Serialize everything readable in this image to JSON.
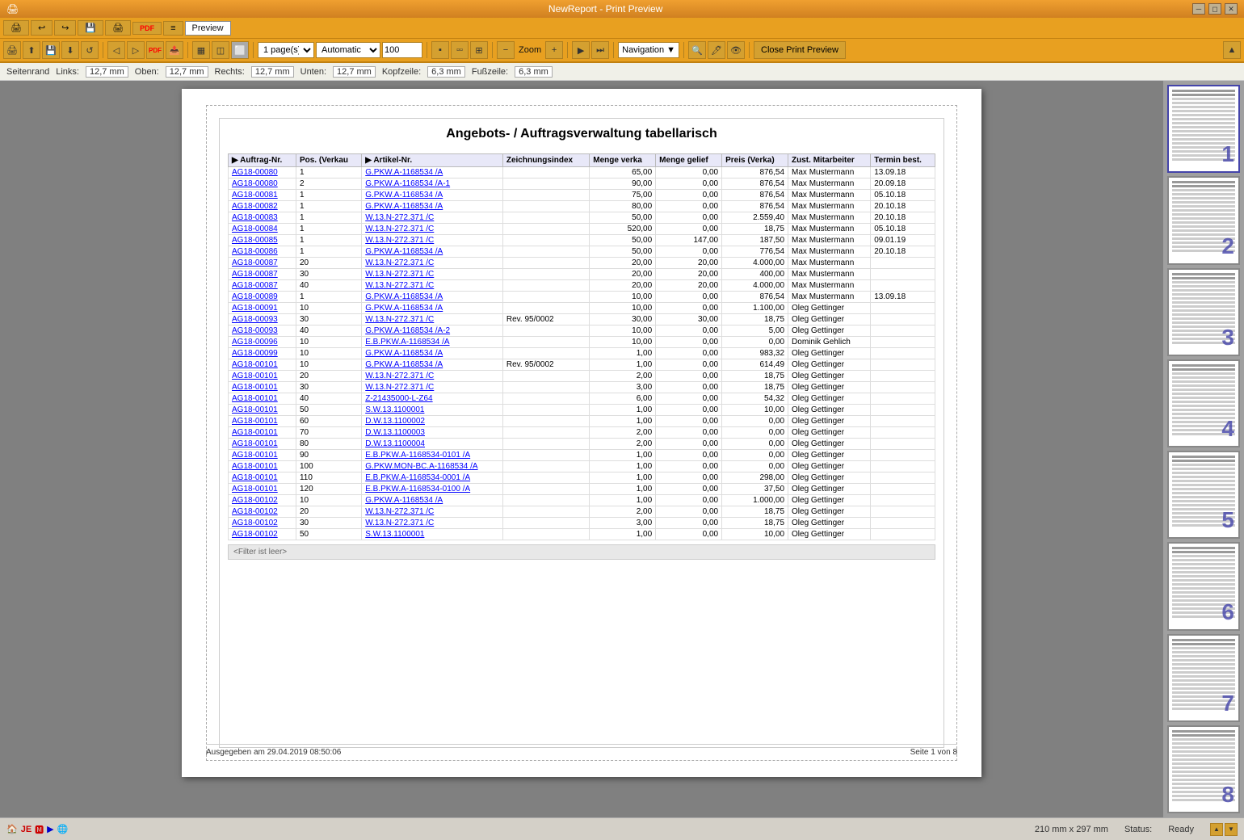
{
  "window": {
    "title": "NewReport - Print Preview",
    "app_icon": "🖨"
  },
  "menu": {
    "items": [
      "Preview"
    ]
  },
  "toolbar": {
    "pages_select": "1 page(s)",
    "zoom_mode": "Automatic",
    "zoom_value": "100",
    "navigation_label": "Navigation",
    "close_label": "Close Print Preview",
    "zoom_label": "Zoom"
  },
  "margins": {
    "seitenrand": "Seitenrand",
    "links_label": "Links:",
    "links_val": "12,7 mm",
    "oben_label": "Oben:",
    "oben_val": "12,7 mm",
    "rechts_label": "Rechts:",
    "rechts_val": "12,7 mm",
    "unten_label": "Unten:",
    "unten_val": "12,7 mm",
    "kopfzeile_label": "Kopfzeile:",
    "kopfzeile_val": "6,3 mm",
    "fusszeile_label": "Fußzeile:",
    "fusszeile_val": "6,3 mm"
  },
  "report": {
    "title": "Angebots- / Auftragsverwaltung tabellarisch",
    "columns": [
      "▶ Auftrag-Nr.",
      "Pos. (Verkau",
      "▶ Artikel-Nr.",
      "Zeichnungsindex",
      "Menge verka",
      "Menge gelief",
      "Preis (Verka)",
      "Zust. Mitarbeiter",
      "Termin best."
    ],
    "rows": [
      [
        "AG18-00080",
        "1",
        "G.PKW.A-1168534 /A",
        "",
        "65,00",
        "0,00",
        "876,54",
        "Max Mustermann",
        "13.09.18"
      ],
      [
        "AG18-00080",
        "2",
        "G.PKW.A-1168534 /A-1",
        "",
        "90,00",
        "0,00",
        "876,54",
        "Max Mustermann",
        "20.09.18"
      ],
      [
        "AG18-00081",
        "1",
        "G.PKW.A-1168534 /A",
        "",
        "75,00",
        "0,00",
        "876,54",
        "Max Mustermann",
        "05.10.18"
      ],
      [
        "AG18-00082",
        "1",
        "G.PKW.A-1168534 /A",
        "",
        "80,00",
        "0,00",
        "876,54",
        "Max Mustermann",
        "20.10.18"
      ],
      [
        "AG18-00083",
        "1",
        "W.13.N-272.371 /C",
        "",
        "50,00",
        "0,00",
        "2.559,40",
        "Max Mustermann",
        "20.10.18"
      ],
      [
        "AG18-00084",
        "1",
        "W.13.N-272.371 /C",
        "",
        "520,00",
        "0,00",
        "18,75",
        "Max Mustermann",
        "05.10.18"
      ],
      [
        "AG18-00085",
        "1",
        "W.13.N-272.371 /C",
        "",
        "50,00",
        "147,00",
        "187,50",
        "Max Mustermann",
        "09.01.19"
      ],
      [
        "AG18-00086",
        "1",
        "G.PKW.A-1168534 /A",
        "",
        "50,00",
        "0,00",
        "776,54",
        "Max Mustermann",
        "20.10.18"
      ],
      [
        "AG18-00087",
        "20",
        "W.13.N-272.371 /C",
        "",
        "20,00",
        "20,00",
        "4.000,00",
        "Max Mustermann",
        ""
      ],
      [
        "AG18-00087",
        "30",
        "W.13.N-272.371 /C",
        "",
        "20,00",
        "20,00",
        "400,00",
        "Max Mustermann",
        ""
      ],
      [
        "AG18-00087",
        "40",
        "W.13.N-272.371 /C",
        "",
        "20,00",
        "20,00",
        "4.000,00",
        "Max Mustermann",
        ""
      ],
      [
        "AG18-00089",
        "1",
        "G.PKW.A-1168534 /A",
        "",
        "10,00",
        "0,00",
        "876,54",
        "Max Mustermann",
        "13.09.18"
      ],
      [
        "AG18-00091",
        "10",
        "G.PKW.A-1168534 /A",
        "",
        "10,00",
        "0,00",
        "1.100,00",
        "Oleg Gettinger",
        ""
      ],
      [
        "AG18-00093",
        "30",
        "W.13.N-272.371 /C",
        "Rev. 95/0002",
        "30,00",
        "30,00",
        "18,75",
        "Oleg Gettinger",
        ""
      ],
      [
        "AG18-00093",
        "40",
        "G.PKW.A-1168534 /A-2",
        "",
        "10,00",
        "0,00",
        "5,00",
        "Oleg Gettinger",
        ""
      ],
      [
        "AG18-00096",
        "10",
        "E.B.PKW.A-1168534 /A",
        "",
        "10,00",
        "0,00",
        "0,00",
        "Dominik Gehlich",
        ""
      ],
      [
        "AG18-00099",
        "10",
        "G.PKW.A-1168534 /A",
        "",
        "1,00",
        "0,00",
        "983,32",
        "Oleg Gettinger",
        ""
      ],
      [
        "AG18-00101",
        "10",
        "G.PKW.A-1168534 /A",
        "Rev. 95/0002",
        "1,00",
        "0,00",
        "614,49",
        "Oleg Gettinger",
        ""
      ],
      [
        "AG18-00101",
        "20",
        "W.13.N-272.371 /C",
        "",
        "2,00",
        "0,00",
        "18,75",
        "Oleg Gettinger",
        ""
      ],
      [
        "AG18-00101",
        "30",
        "W.13.N-272.371 /C",
        "",
        "3,00",
        "0,00",
        "18,75",
        "Oleg Gettinger",
        ""
      ],
      [
        "AG18-00101",
        "40",
        "Z-21435000-L-Z64",
        "",
        "6,00",
        "0,00",
        "54,32",
        "Oleg Gettinger",
        ""
      ],
      [
        "AG18-00101",
        "50",
        "S.W.13.1100001",
        "",
        "1,00",
        "0,00",
        "10,00",
        "Oleg Gettinger",
        ""
      ],
      [
        "AG18-00101",
        "60",
        "D.W.13.1100002",
        "",
        "1,00",
        "0,00",
        "0,00",
        "Oleg Gettinger",
        ""
      ],
      [
        "AG18-00101",
        "70",
        "D.W.13.1100003",
        "",
        "2,00",
        "0,00",
        "0,00",
        "Oleg Gettinger",
        ""
      ],
      [
        "AG18-00101",
        "80",
        "D.W.13.1100004",
        "",
        "2,00",
        "0,00",
        "0,00",
        "Oleg Gettinger",
        ""
      ],
      [
        "AG18-00101",
        "90",
        "E.B.PKW.A-1168534-0101 /A",
        "",
        "1,00",
        "0,00",
        "0,00",
        "Oleg Gettinger",
        ""
      ],
      [
        "AG18-00101",
        "100",
        "G.PKW.MON-BC.A-1168534 /A",
        "",
        "1,00",
        "0,00",
        "0,00",
        "Oleg Gettinger",
        ""
      ],
      [
        "AG18-00101",
        "110",
        "E.B.PKW.A-1168534-0001 /A",
        "",
        "1,00",
        "0,00",
        "298,00",
        "Oleg Gettinger",
        ""
      ],
      [
        "AG18-00101",
        "120",
        "E.B.PKW.A-1168534-0100 /A",
        "",
        "1,00",
        "0,00",
        "37,50",
        "Oleg Gettinger",
        ""
      ],
      [
        "AG18-00102",
        "10",
        "G.PKW.A-1168534 /A",
        "",
        "1,00",
        "0,00",
        "1.000,00",
        "Oleg Gettinger",
        ""
      ],
      [
        "AG18-00102",
        "20",
        "W.13.N-272.371 /C",
        "",
        "2,00",
        "0,00",
        "18,75",
        "Oleg Gettinger",
        ""
      ],
      [
        "AG18-00102",
        "30",
        "W.13.N-272.371 /C",
        "",
        "3,00",
        "0,00",
        "18,75",
        "Oleg Gettinger",
        ""
      ],
      [
        "AG18-00102",
        "50",
        "S.W.13.1100001",
        "",
        "1,00",
        "0,00",
        "10,00",
        "Oleg Gettinger",
        ""
      ]
    ],
    "filter_text": "<Filter ist leer>",
    "footer_left": "Ausgegeben am  29.04.2019 08:50:06",
    "footer_right": "Seite  1 von 8"
  },
  "thumbnails": [
    1,
    2,
    3,
    4,
    5,
    6,
    7,
    8
  ],
  "statusbar": {
    "size": "210 mm x 297 mm",
    "status": "Status:",
    "status_val": "Ready"
  }
}
